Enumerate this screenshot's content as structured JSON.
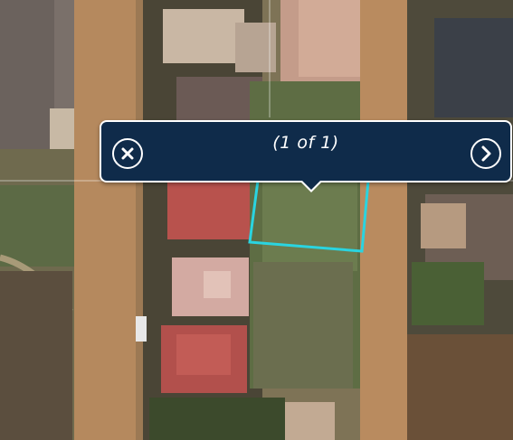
{
  "map": {
    "basemap": "satellite-imagery",
    "selection_outline_color": "#2ad4e0",
    "grid_line_color": "#ffffff"
  },
  "popup": {
    "counter_text": "(1 of 1)",
    "close_icon": "close-icon",
    "next_icon": "chevron-right-icon",
    "background_color": "#0f2b4a",
    "border_color": "#ffffff"
  }
}
